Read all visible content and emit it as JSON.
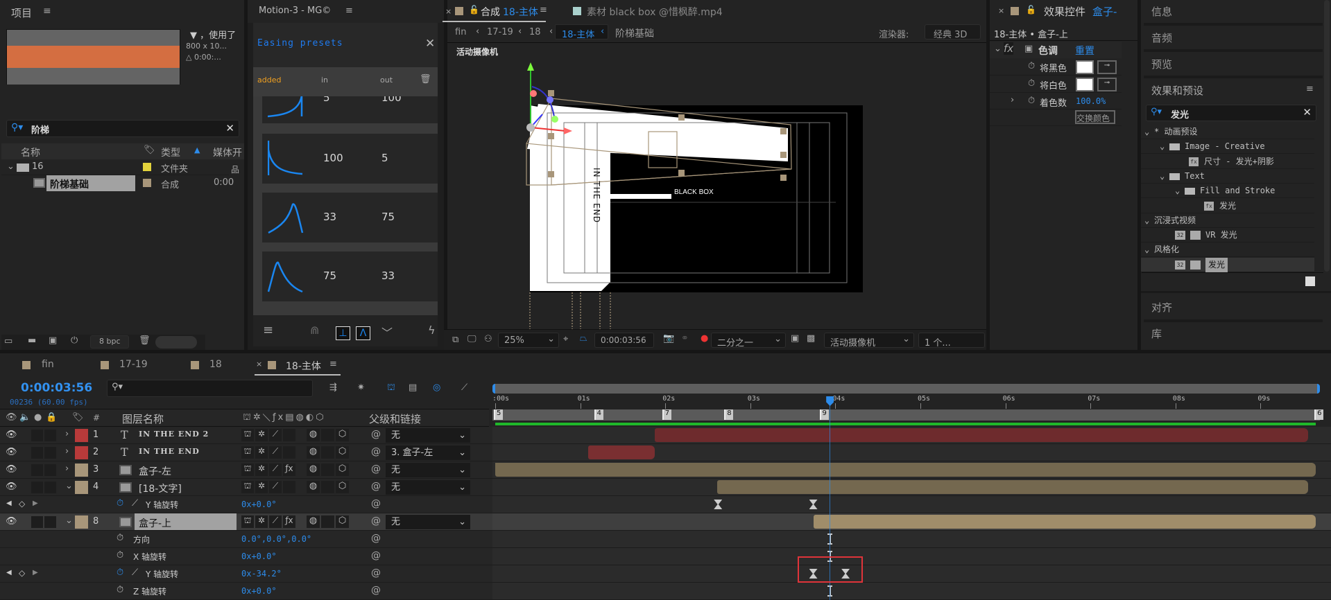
{
  "project": {
    "title": "项目",
    "info_line1": "▼ ，使用了",
    "info_line2": "800 x 10...",
    "info_line3": "△ 0:00:...",
    "search_value": "阶梯",
    "columns": {
      "name": "名称",
      "type": "类型",
      "media": "媒体开"
    },
    "items": [
      {
        "name": "16",
        "type": "文件夹",
        "label_color": "#e3d33c",
        "icon": "folder-icon"
      },
      {
        "name": "阶梯基础",
        "type": "合成",
        "duration": "0:00",
        "label_color": "#a8967a",
        "icon": "composition-icon",
        "selected": true
      }
    ],
    "bpc": "8 bpc",
    "thumbnail_colors": [
      "#646464",
      "#d46e41",
      "#646464"
    ]
  },
  "motion": {
    "title": "Motion-3 - MG©",
    "heading": "Easing presets",
    "col_added": "added",
    "col_in": "in",
    "col_out": "out",
    "presets": [
      {
        "in": "5",
        "out": "100"
      },
      {
        "in": "100",
        "out": "5"
      },
      {
        "in": "33",
        "out": "75"
      },
      {
        "in": "75",
        "out": "33"
      }
    ]
  },
  "comp": {
    "tab_prefix": "合成",
    "tab_name": "18-主体",
    "footage_tab": "素材 black box @惜枫醉.mp4",
    "breadcrumbs": [
      "fin",
      "17-19",
      "18",
      "18-主体",
      "阶梯基础"
    ],
    "renderer_label": "渲染器:",
    "renderer_value": "经典 3D",
    "view_label": "活动摄像机",
    "vertical_text": "IN THE END",
    "box_text": "BLACK BOX",
    "zoom": "25%",
    "timecode": "0:00:03:56",
    "resolution": "二分之一",
    "camera": "活动摄像机",
    "views": "1 个..."
  },
  "effect_controls": {
    "tab_title": "效果控件",
    "tab_layer": "盒子-",
    "subtitle": "18-主体 • 盒子-上",
    "effect_name": "色调",
    "reset": "重置",
    "map_black": "将黑色",
    "map_white": "将白色",
    "amount_label": "着色数",
    "amount_value": "100.0%",
    "swap": "交换颜色"
  },
  "right": {
    "info": "信息",
    "audio": "音频",
    "preview": "预览",
    "effects_title": "效果和预设",
    "search_value": "发光",
    "tree": [
      {
        "label": "* 动画预设",
        "depth": 0,
        "kind": "group"
      },
      {
        "label": "Image - Creative",
        "depth": 1,
        "kind": "folder"
      },
      {
        "label": "尺寸 - 发光+阴影",
        "depth": 2,
        "kind": "preset"
      },
      {
        "label": "Text",
        "depth": 1,
        "kind": "folder"
      },
      {
        "label": "Fill and Stroke",
        "depth": 2,
        "kind": "folder"
      },
      {
        "label": "发光",
        "depth": 3,
        "kind": "preset"
      },
      {
        "label": "沉浸式视频",
        "depth": 0,
        "kind": "group"
      },
      {
        "label": "VR 发光",
        "depth": 1,
        "kind": "effect"
      },
      {
        "label": "风格化",
        "depth": 0,
        "kind": "group"
      },
      {
        "label": "发光",
        "depth": 1,
        "kind": "effect",
        "selected": true
      }
    ],
    "align": "对齐",
    "library": "库"
  },
  "timeline": {
    "tabs": [
      "fin",
      "17-19",
      "18",
      "18-主体"
    ],
    "timecode": "0:00:03:56",
    "frame_info": "00236 (60.00 fps)",
    "col_layer_name": "图层名称",
    "col_parent": "父级和链接",
    "col_hash": "#",
    "ruler_labels": [
      ":00s",
      "01s",
      "02s",
      "03s",
      "04s",
      "05s",
      "06s",
      "07s",
      "08s",
      "09s"
    ],
    "current_time_s": 3.933,
    "markers": [
      {
        "label": "5",
        "time_s": 0
      },
      {
        "label": "4",
        "time_s": 1.18
      },
      {
        "label": "7",
        "time_s": 1.98
      },
      {
        "label": "8",
        "time_s": 2.71
      },
      {
        "label": "9",
        "time_s": 3.83
      },
      {
        "label": "6",
        "time_s": 9.65
      }
    ],
    "rows": [
      {
        "kind": "layer",
        "num": "1",
        "type": "text",
        "name": "IN THE END 2",
        "label_color": "#b83a3a",
        "parent": "无",
        "fx": false,
        "bar": {
          "in_s": 1.88,
          "out_s": 9.56,
          "color": "#6e2b2d"
        }
      },
      {
        "kind": "layer",
        "num": "2",
        "type": "text",
        "name": "IN THE END",
        "label_color": "#b83a3a",
        "parent": "3. 盒子-左",
        "fx": false,
        "bar": {
          "in_s": 1.09,
          "out_s": 1.88,
          "color": "#7a2f31"
        }
      },
      {
        "kind": "layer",
        "num": "3",
        "type": "comp",
        "name": "盒子-左",
        "label_color": "#a8967a",
        "parent": "无",
        "fx": true,
        "bar": {
          "in_s": 0,
          "out_s": 9.65,
          "color": "#74684f"
        }
      },
      {
        "kind": "layer",
        "num": "4",
        "type": "comp",
        "name": "[18-文字]",
        "label_color": "#a8967a",
        "parent": "无",
        "fx": false,
        "expanded": true,
        "bar": {
          "in_s": 2.61,
          "out_s": 9.56,
          "color": "#74684f"
        }
      },
      {
        "kind": "prop",
        "name": "Y 轴旋转",
        "value": "0x+0.0°",
        "keyframed": true,
        "keys_s": [
          2.62,
          3.74
        ]
      },
      {
        "kind": "layer",
        "num": "8",
        "type": "comp",
        "name": "盒子-上",
        "label_color": "#a8967a",
        "parent": "无",
        "fx": true,
        "expanded": true,
        "selected": true,
        "bar": {
          "in_s": 3.74,
          "out_s": 9.65,
          "color": "#a08d6a"
        }
      },
      {
        "kind": "prop",
        "name": "方向",
        "value": "0.0°,0.0°,0.0°",
        "keyframed": false
      },
      {
        "kind": "prop",
        "name": "X 轴旋转",
        "value": "0x+0.0°",
        "keyframed": false
      },
      {
        "kind": "prop",
        "name": "Y 轴旋转",
        "value": "0x-34.2°",
        "keyframed": true,
        "keys_s": [
          3.74,
          4.12
        ],
        "highlight": true
      },
      {
        "kind": "prop",
        "name": "Z 轴旋转",
        "value": "0x+0.0°",
        "keyframed": false
      }
    ]
  },
  "colors": {
    "accent": "#2d8ceb",
    "orange": "#f0a020",
    "highlight_box": "#e0343a",
    "timeline_green": "#1fb82a"
  }
}
